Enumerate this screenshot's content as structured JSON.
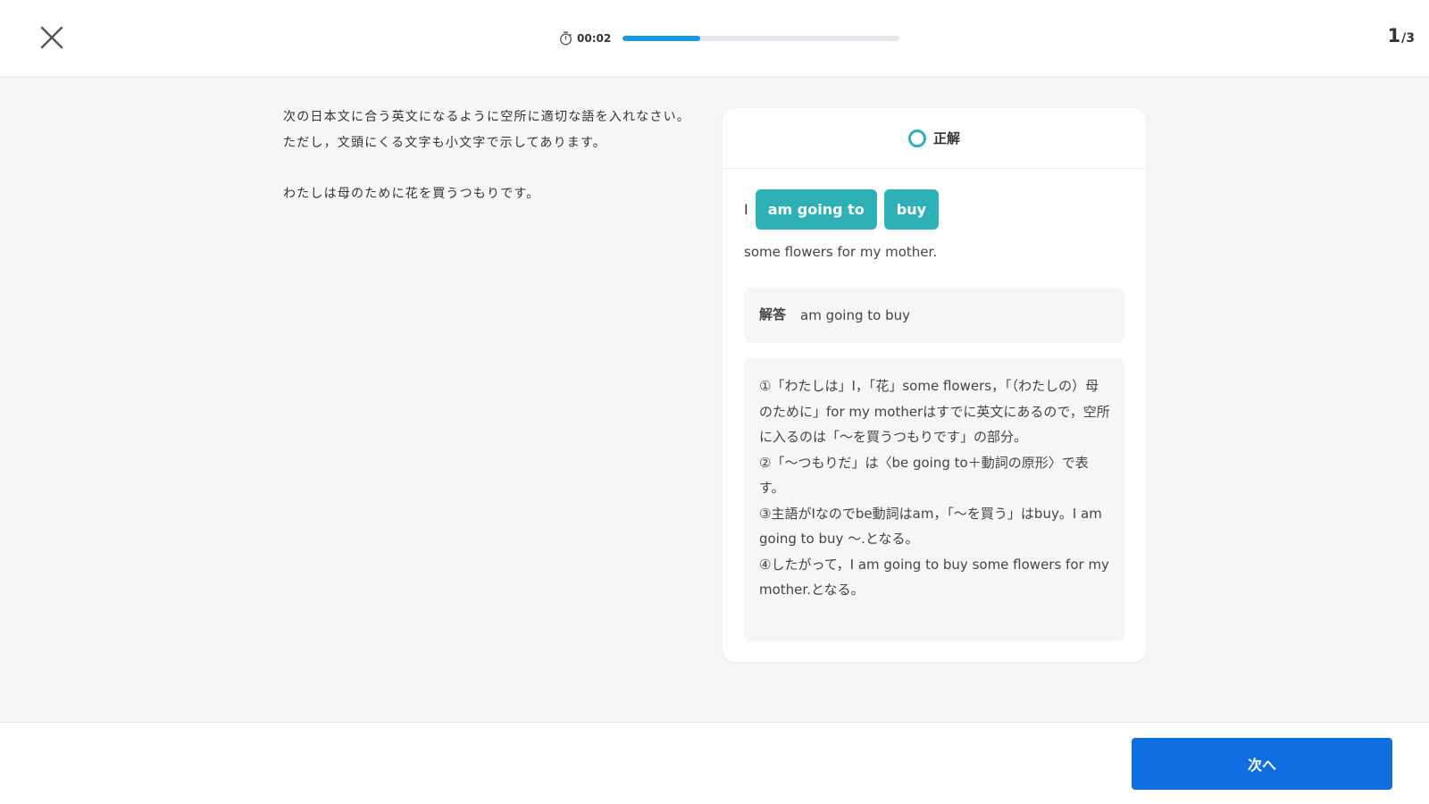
{
  "colors": {
    "accent_teal": "#2eb0b7",
    "progress_blue": "#1a9bd7",
    "primary_button": "#0f6fe0",
    "background": "#f5f6f8"
  },
  "header": {
    "close_icon": "close-x-icon",
    "timer_icon": "stopwatch-icon",
    "timer": "00:02",
    "progress_percent": 28,
    "counter": {
      "current": "1",
      "total": "/3"
    }
  },
  "question": {
    "instruction": "次の日本文に合う英文になるように空所に適切な語を入れなさい。ただし，文頭にくる文字も小文字で示してあります。",
    "sentence": "わたしは母のために花を買うつもりです。"
  },
  "result": {
    "status_icon": "circle-correct-icon",
    "status_label": "正解",
    "lead_word": "I",
    "chips": [
      "am going to",
      "buy"
    ],
    "rest": "some flowers for my mother.",
    "answer_label": "解答",
    "answer_value": "am going to buy",
    "explanation": [
      "①「わたしは」I，「花」some flowers，「（わたしの）母のために」for my motherはすでに英文にあるので，空所に入るのは「～を買うつもりです」の部分。",
      "②「～つもりだ」は〈be going to＋動詞の原形〉で表す。",
      "③主語がIなのでbe動詞はam，「～を買う」はbuy。I am going to buy ～.となる。",
      "④したがって，I am going to buy some flowers for my mother.となる。"
    ]
  },
  "footer": {
    "next_label": "次へ"
  }
}
